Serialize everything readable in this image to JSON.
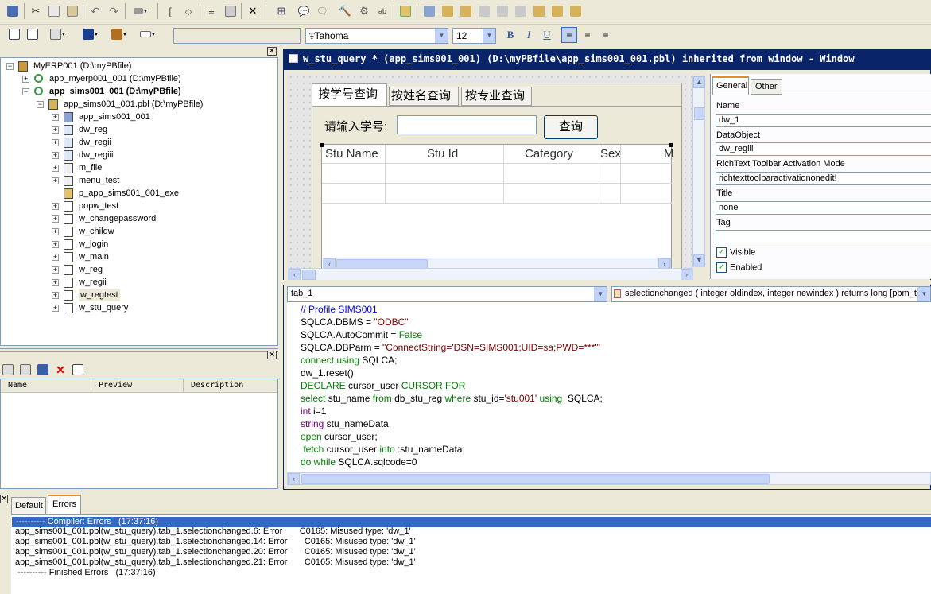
{
  "toolbar": {
    "font_name": "Tahoma",
    "font_size": "12",
    "bold_label": "B",
    "italic_label": "I",
    "underline_label": "U",
    "empty_field": ""
  },
  "tree": {
    "items": [
      {
        "label": "MyERP001 (D:\\myPBfile)",
        "bold": false
      },
      {
        "label": "app_myerp001_001 (D:\\myPBfile)",
        "bold": false
      },
      {
        "label": "app_sims001_001 (D:\\myPBfile)",
        "bold": true
      },
      {
        "label": "app_sims001_001.pbl (D:\\myPBfile)",
        "bold": false
      },
      {
        "label": "app_sims001_001",
        "bold": false
      },
      {
        "label": "dw_reg",
        "bold": false
      },
      {
        "label": "dw_regii",
        "bold": false
      },
      {
        "label": "dw_regiii",
        "bold": false
      },
      {
        "label": "m_file",
        "bold": false
      },
      {
        "label": "menu_test",
        "bold": false
      },
      {
        "label": "p_app_sims001_001_exe",
        "bold": false
      },
      {
        "label": "popw_test",
        "bold": false
      },
      {
        "label": "w_changepassword",
        "bold": false
      },
      {
        "label": "w_childw",
        "bold": false
      },
      {
        "label": "w_login",
        "bold": false
      },
      {
        "label": "w_main",
        "bold": false
      },
      {
        "label": "w_reg",
        "bold": false
      },
      {
        "label": "w_regii",
        "bold": false
      },
      {
        "label": "w_regtest",
        "bold": false
      },
      {
        "label": "w_stu_query",
        "bold": false
      }
    ]
  },
  "library": {
    "columns": [
      "Name",
      "Preview",
      "Description"
    ]
  },
  "editor": {
    "title": "w_stu_query * (app_sims001_001) (D:\\myPBfile\\app_sims001_001.pbl) inherited from window - Window"
  },
  "design": {
    "tabs": [
      "按学号查询",
      "按姓名查询",
      "按专业查询"
    ],
    "prompt_label": "请输入学号:",
    "query_button": "查询",
    "input_value": "",
    "grid_headers": [
      "Stu Name",
      "Stu Id",
      "Category",
      "Sex",
      "M"
    ]
  },
  "properties": {
    "tabs": [
      "General",
      "Other"
    ],
    "name_label": "Name",
    "name_value": "dw_1",
    "dataobject_label": "DataObject",
    "dataobject_value": "dw_regiii",
    "richtext_label": "RichText Toolbar Activation Mode",
    "richtext_value": "richtexttoolbaractivationonedit!",
    "title_label": "Title",
    "title_value": "none",
    "tag_label": "Tag",
    "tag_value": "",
    "visible_label": "Visible",
    "enabled_label": "Enabled",
    "visible_checked": true,
    "enabled_checked": true
  },
  "script": {
    "object_select": "tab_1",
    "event_select": "selectionchanged ( integer oldindex, integer newindex )  returns long [pbm_t"
  },
  "output": {
    "tabs": [
      "Default",
      "Errors"
    ],
    "header": "---------- Compiler: Errors   (17:37:16)",
    "lines": [
      "app_sims001_001.pbl(w_stu_query).tab_1.selectionchanged.6: Error       C0165: Misused type: 'dw_1'",
      "app_sims001_001.pbl(w_stu_query).tab_1.selectionchanged.14: Error       C0165: Misused type: 'dw_1'",
      "app_sims001_001.pbl(w_stu_query).tab_1.selectionchanged.20: Error       C0165: Misused type: 'dw_1'",
      "app_sims001_001.pbl(w_stu_query).tab_1.selectionchanged.21: Error       C0165: Misused type: 'dw_1'"
    ],
    "footer": " ---------- Finished Errors   (17:37:16)"
  },
  "colors": {
    "title_bar": "#0a246a",
    "accent": "#316ac5",
    "keyword": "#008000",
    "constant": "#0000ff",
    "string": "#800000"
  }
}
